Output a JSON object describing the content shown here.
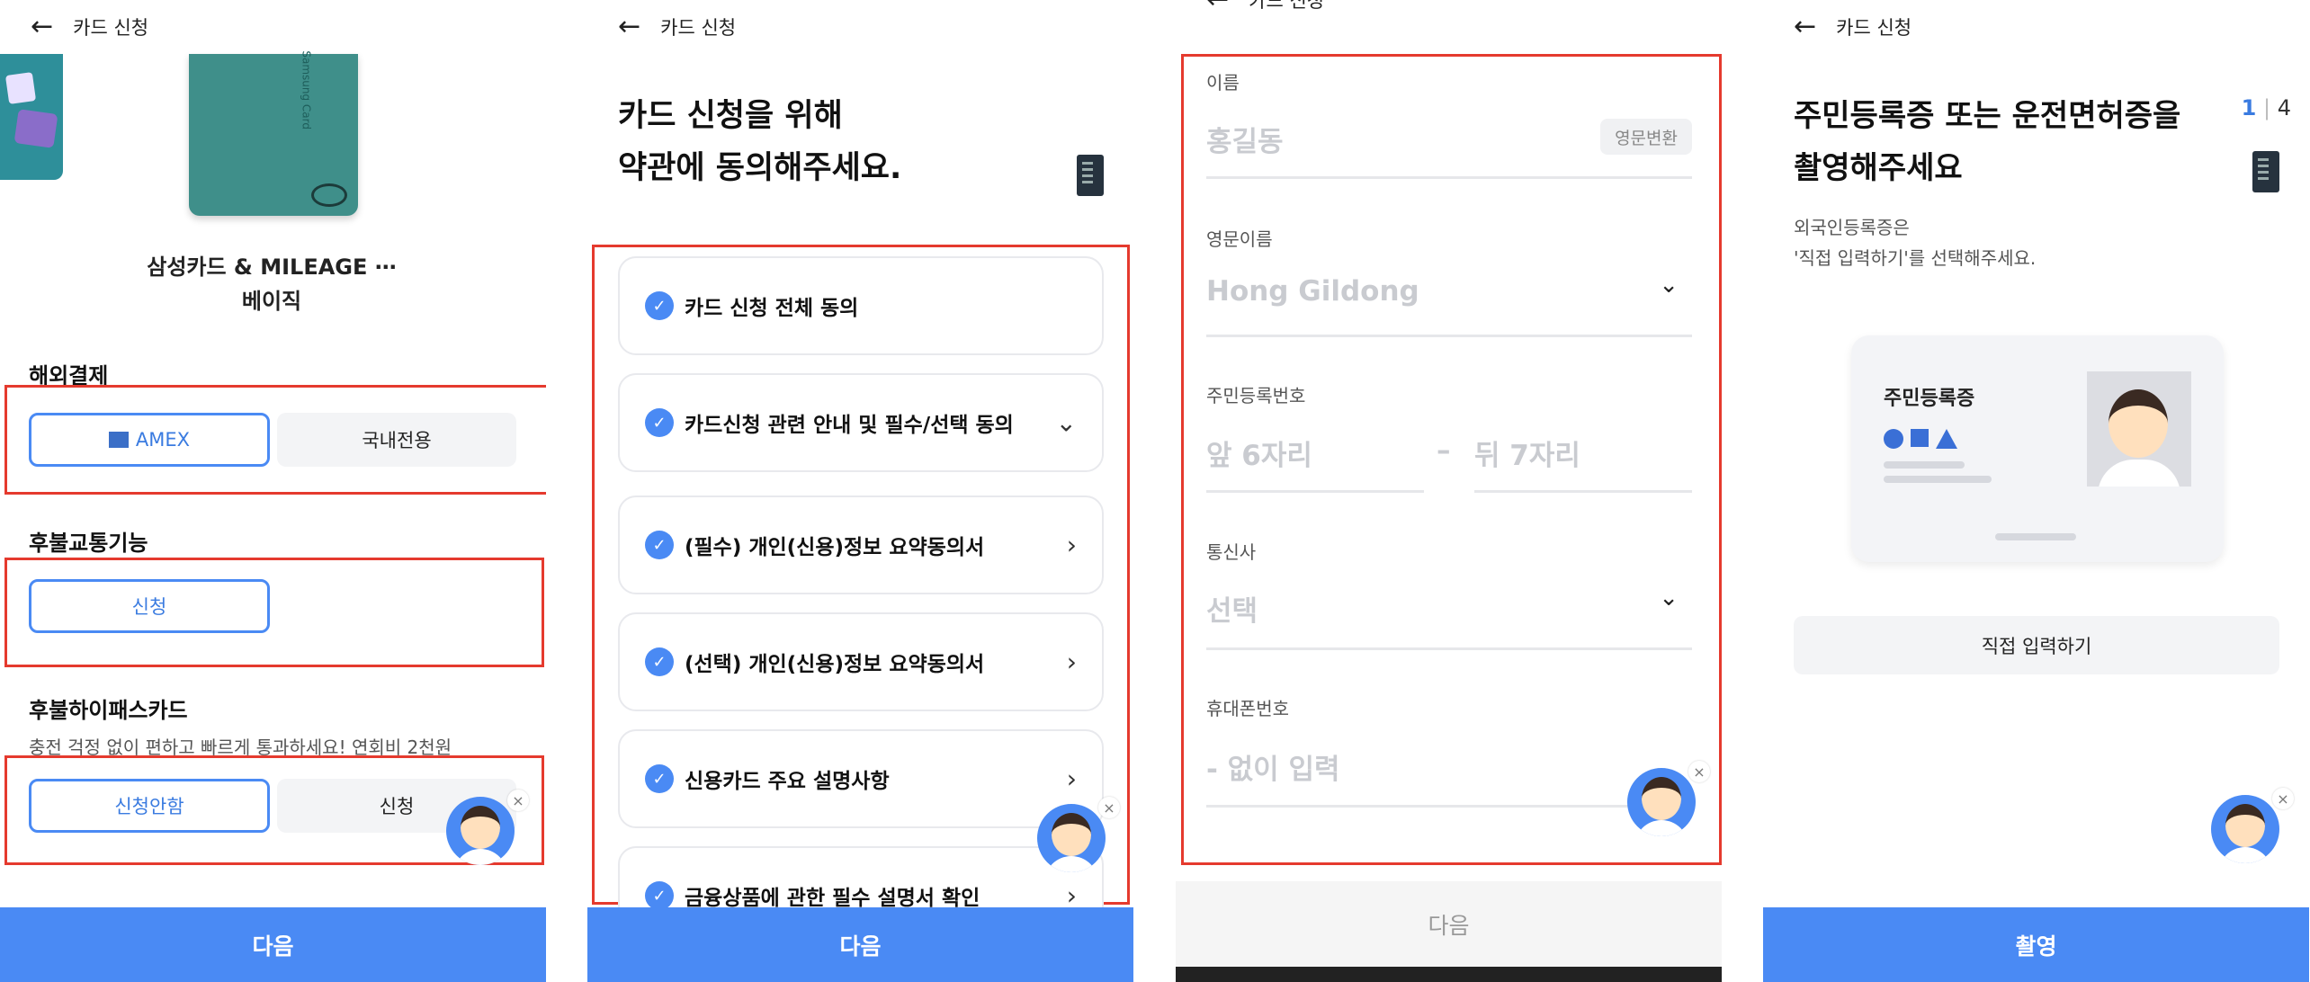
{
  "colors": {
    "primary": "#4a8af4",
    "highlight_box": "#e53a2e"
  },
  "screen1": {
    "header_title": "카드 신청",
    "card_brand_text": "Samsung Card",
    "card_name_line1": "삼성카드 & MILEAGE ⋯",
    "card_name_line2": "베이직",
    "overseas_title": "해외결제",
    "overseas_options": [
      "AMEX",
      "국내전용"
    ],
    "transit_title": "후불교통기능",
    "transit_option": "신청",
    "hipass_title": "후불하이패스카드",
    "hipass_desc": "충전 걱정 없이 편하고 빠르게 통과하세요! 연회비 2천원",
    "hipass_options": [
      "신청안함",
      "신청"
    ],
    "next_label": "다음"
  },
  "screen2": {
    "header_title": "카드 신청",
    "title_line1": "카드 신청을 위해",
    "title_line2": "약관에 동의해주세요.",
    "terms": [
      "카드 신청 전체 동의",
      "카드신청 관련 안내 및 필수/선택 동의",
      "(필수) 개인(신용)정보 요약동의서",
      "(선택) 개인(신용)정보 요약동의서",
      "신용카드 주요 설명사항",
      "금융상품에 관한 필수 설명서 확인"
    ],
    "next_label": "다음"
  },
  "screen3": {
    "header_title": "카드 신청",
    "name_label": "이름",
    "name_placeholder": "홍길동",
    "convert_label": "영문변환",
    "eng_name_label": "영문이름",
    "eng_name_placeholder": "Hong Gildong",
    "rrn_label": "주민등록번호",
    "rrn_front_placeholder": "앞 6자리",
    "rrn_dash": "–",
    "rrn_back_placeholder": "뒤 7자리",
    "carrier_label": "통신사",
    "carrier_placeholder": "선택",
    "phone_label": "휴대폰번호",
    "phone_placeholder": "- 없이 입력",
    "next_label": "다음"
  },
  "screen4": {
    "header_title": "카드 신청",
    "title_line1": "주민등록증 또는 운전면허증을",
    "title_line2": "촬영해주세요",
    "pager_current": "1",
    "pager_total": "4",
    "sub_line1": "외국인등록증은",
    "sub_line2": "'직접 입력하기'를 선택해주세요.",
    "id_card_label": "주민등록증",
    "manual_label": "직접 입력하기",
    "shoot_label": "촬영"
  },
  "icons": {
    "back": "←",
    "check": "✓",
    "chevron_down": "⌄",
    "chevron_right": "›",
    "close": "×"
  }
}
